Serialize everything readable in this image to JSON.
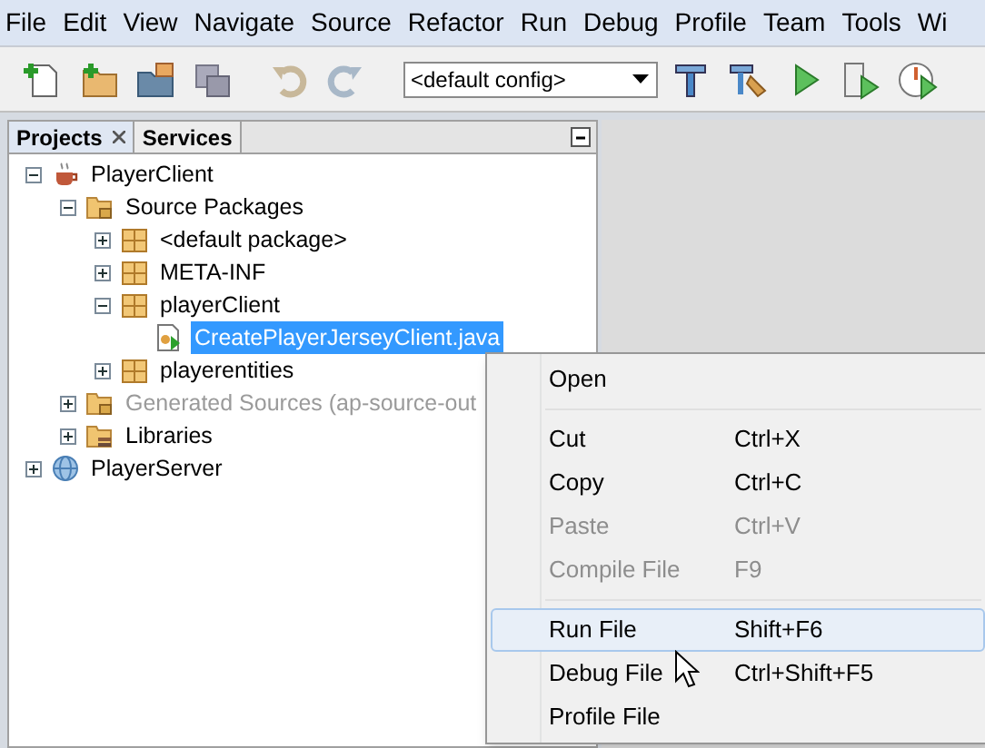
{
  "menu_bar": [
    "File",
    "Edit",
    "View",
    "Navigate",
    "Source",
    "Refactor",
    "Run",
    "Debug",
    "Profile",
    "Team",
    "Tools",
    "Wi"
  ],
  "toolbar": {
    "config": {
      "value": "<default config>"
    }
  },
  "panel": {
    "tabs": [
      {
        "label": "Projects",
        "selected": true,
        "closable": true
      },
      {
        "label": "Services",
        "selected": false,
        "closable": false
      }
    ],
    "tree": [
      {
        "label": "PlayerClient",
        "kind": "project",
        "expanded": true,
        "selected": false,
        "disabled": false,
        "children": [
          {
            "label": "Source Packages",
            "kind": "source-folder",
            "expanded": true,
            "selected": false,
            "disabled": false,
            "children": [
              {
                "label": "<default package>",
                "kind": "package",
                "expanded": false,
                "selected": false,
                "disabled": false
              },
              {
                "label": "META-INF",
                "kind": "package",
                "expanded": false,
                "selected": false,
                "disabled": false
              },
              {
                "label": "playerClient",
                "kind": "package",
                "expanded": true,
                "selected": false,
                "disabled": false,
                "children": [
                  {
                    "label": "CreatePlayerJerseyClient.java",
                    "kind": "java-file",
                    "selected": true,
                    "disabled": false
                  }
                ]
              },
              {
                "label": "playerentities",
                "kind": "package",
                "expanded": false,
                "selected": false,
                "disabled": false
              }
            ]
          },
          {
            "label": "Generated Sources (ap-source-out",
            "kind": "source-folder",
            "expanded": false,
            "selected": false,
            "disabled": true
          },
          {
            "label": "Libraries",
            "kind": "library",
            "expanded": false,
            "selected": false,
            "disabled": false
          }
        ]
      },
      {
        "label": "PlayerServer",
        "kind": "web-project",
        "expanded": false,
        "selected": false,
        "disabled": false
      }
    ]
  },
  "context_menu": [
    {
      "kind": "item",
      "label": "Open",
      "disabled": false,
      "selected": false
    },
    {
      "kind": "separator"
    },
    {
      "kind": "item",
      "label": "Cut",
      "shortcut": "Ctrl+X",
      "disabled": false,
      "selected": false
    },
    {
      "kind": "item",
      "label": "Copy",
      "shortcut": "Ctrl+C",
      "disabled": false,
      "selected": false
    },
    {
      "kind": "item",
      "label": "Paste",
      "shortcut": "Ctrl+V",
      "disabled": true,
      "selected": false
    },
    {
      "kind": "item",
      "label": "Compile File",
      "shortcut": "F9",
      "disabled": true,
      "selected": false
    },
    {
      "kind": "separator"
    },
    {
      "kind": "item",
      "label": "Run File",
      "shortcut": "Shift+F6",
      "disabled": false,
      "selected": true
    },
    {
      "kind": "item",
      "label": "Debug File",
      "shortcut": "Ctrl+Shift+F5",
      "disabled": false,
      "selected": false
    },
    {
      "kind": "item",
      "label": "Profile File",
      "disabled": false,
      "selected": false
    }
  ]
}
